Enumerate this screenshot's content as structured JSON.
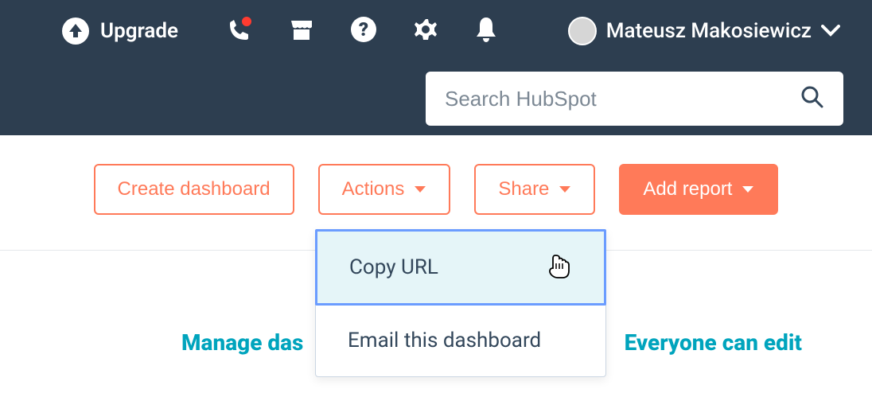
{
  "nav": {
    "upgrade_label": "Upgrade",
    "user_name": "Mateusz Makosiewicz"
  },
  "search": {
    "placeholder": "Search HubSpot"
  },
  "toolbar": {
    "create_dashboard_label": "Create dashboard",
    "actions_label": "Actions",
    "share_label": "Share",
    "add_report_label": "Add report"
  },
  "share_menu": {
    "copy_url_label": "Copy URL",
    "email_dashboard_label": "Email this dashboard"
  },
  "bottom": {
    "manage_label": "Manage das",
    "edit_label": "Everyone can edit"
  },
  "colors": {
    "brand_orange": "#ff7a59",
    "navy": "#2d3e50",
    "teal": "#00a4bd",
    "highlight_bg": "#e5f5f8",
    "highlight_border": "#6b9cff"
  }
}
